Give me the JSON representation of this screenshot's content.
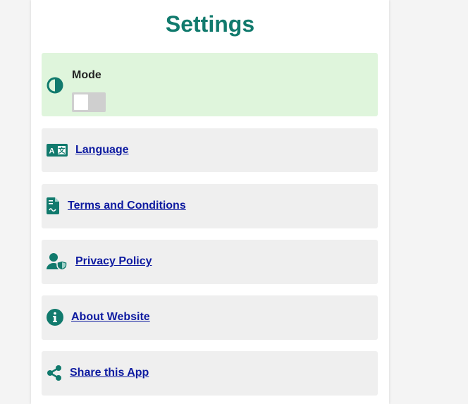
{
  "page": {
    "title": "Settings"
  },
  "mode": {
    "label": "Mode",
    "icon": "contrast-icon",
    "toggle_on": false
  },
  "items": [
    {
      "label": "Language",
      "icon": "language-icon"
    },
    {
      "label": "Terms and Conditions",
      "icon": "document-icon"
    },
    {
      "label": "Privacy Policy",
      "icon": "user-shield-icon"
    },
    {
      "label": "About Website",
      "icon": "info-icon"
    },
    {
      "label": "Share this App",
      "icon": "share-icon"
    }
  ],
  "colors": {
    "accent": "#117a6d",
    "link": "#0d1aa0",
    "mode_card_bg": "#dff5dc",
    "card_bg": "#efefef"
  }
}
